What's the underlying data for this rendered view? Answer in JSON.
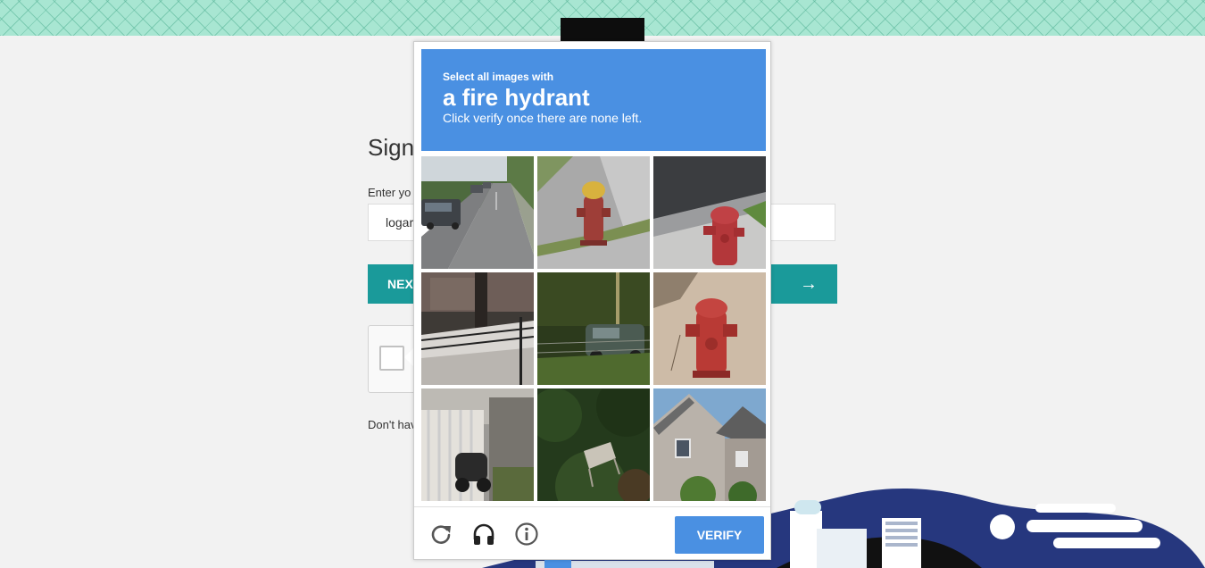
{
  "signin": {
    "title": "Sign",
    "username_label": "Enter yo",
    "username_value": "logar",
    "next_label": "NEX",
    "next_arrow": "→",
    "signup_text": "Don't hav"
  },
  "captcha": {
    "instruction": "Select all images with",
    "object": "a fire hydrant",
    "subtitle": "Click verify once there are none left.",
    "verify_label": "VERIFY",
    "tiles": [
      "street with cars",
      "yellow-topped fire hydrant",
      "red fire hydrant",
      "snowy yard with tree",
      "car behind fence",
      "red fire hydrant",
      "gate with scooter",
      "bushes with object",
      "stone house"
    ]
  },
  "colors": {
    "header_blue": "#4a90e2",
    "next_teal": "#1a9a9a",
    "band_mint": "#a8e6d2",
    "city_navy": "#26377e"
  },
  "icons": [
    "reload-icon",
    "audio-icon",
    "info-icon",
    "arrow-right-icon"
  ]
}
